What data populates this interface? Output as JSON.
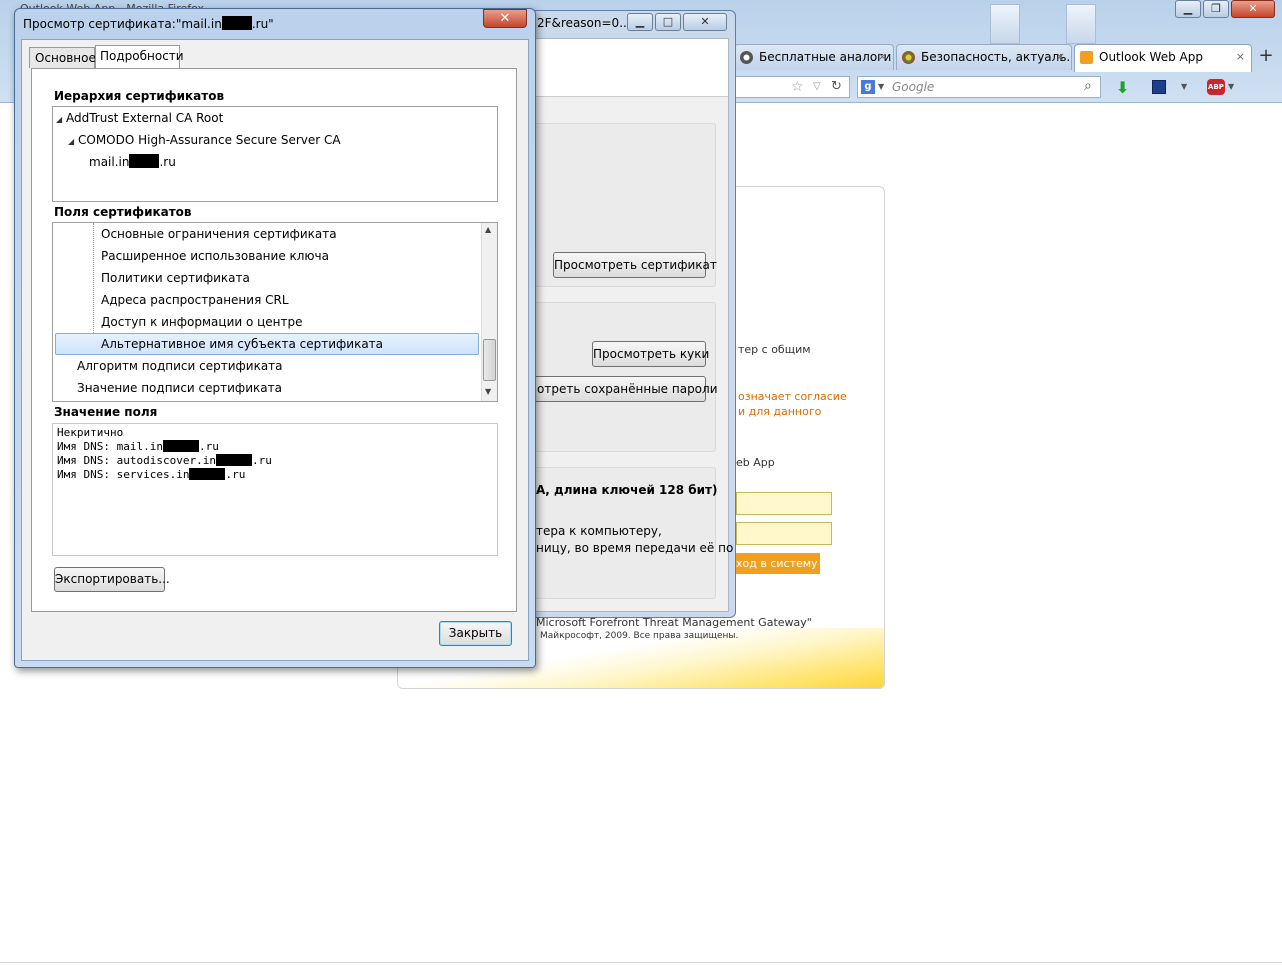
{
  "browser": {
    "title": "Outlook Web App - Mozilla Firefox",
    "tabs": [
      {
        "label": "Бесплатные аналоги п...",
        "close": "×"
      },
      {
        "label": "Безопасность, актуаль...",
        "close": "×"
      },
      {
        "label": "Outlook Web App",
        "close": "×"
      }
    ],
    "new_tab": "+",
    "search_placeholder": "Google",
    "window_buttons": {
      "minimize": "▁",
      "restore": "❐",
      "close": "✕"
    },
    "colors": {
      "download_arrow": "#1aa22c",
      "abp": "#c9252c",
      "owa_accent": "#f0a020"
    }
  },
  "page_info_dialog": {
    "url_fragment": "2F&reason=0...",
    "view_cert_button": "Просмотреть сертификат",
    "view_cookies_button": "Просмотреть куки",
    "view_passwords_button": "мотреть сохранённые пароли",
    "cipher_text": "А, длина ключей 128 бит)",
    "line1": "тера к компьютеру,",
    "line2": "ницу, во время передачи её по"
  },
  "owa_page": {
    "text1": "тер с общим",
    "orange1": "означает согласие",
    "orange2": "и для данного",
    "text2": "eb App",
    "login_button": "ход в систему",
    "footer1": "Microsoft Forefront Threat Management Gateway\"",
    "footer2": "Майкрософт, 2009. Все права защищены."
  },
  "cert_dialog": {
    "title_prefix": "Просмотр сертификата:\"mail.in",
    "title_suffix": ".ru\"",
    "close": "✕",
    "tabs": {
      "general": "Основное",
      "details": "Подробности"
    },
    "hierarchy_label": "Иерархия сертификатов",
    "hierarchy": [
      {
        "label": "AddTrust External CA Root"
      },
      {
        "label": "COMODO High-Assurance Secure Server CA"
      },
      {
        "prefix": "mail.in",
        "suffix": ".ru"
      }
    ],
    "fields_label": "Поля сертификатов",
    "fields": [
      "Основные ограничения сертификата",
      "Расширенное использование ключа",
      "Политики сертификата",
      "Адреса распространения CRL",
      "Доступ к информации о центре",
      "Альтернативное имя субъекта сертификата",
      "Алгоритм подписи сертификата",
      "Значение подписи сертификата"
    ],
    "value_label": "Значение поля",
    "value_lines": [
      {
        "prefix": "Некритично",
        "suffix": ""
      },
      {
        "prefix": "Имя DNS: mail.in",
        "suffix": ".ru"
      },
      {
        "prefix": "Имя DNS: autodiscover.in",
        "suffix": ".ru"
      },
      {
        "prefix": "Имя DNS: services.in",
        "suffix": ".ru"
      }
    ],
    "export_button": "Экспортировать...",
    "close_button": "Закрыть"
  }
}
